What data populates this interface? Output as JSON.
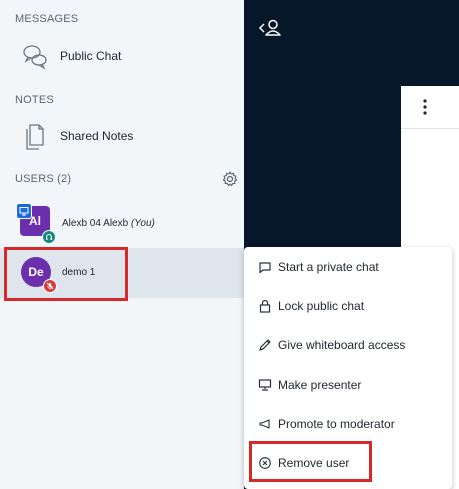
{
  "sidebar": {
    "messages_heading": "MESSAGES",
    "public_chat_label": "Public Chat",
    "notes_heading": "NOTES",
    "shared_notes_label": "Shared Notes",
    "users_heading": "USERS (2)",
    "users": [
      {
        "initials": "Al",
        "name": "Alexb 04 Alexb",
        "suffix": "(You)",
        "avatar_color": "#6b2fad",
        "role_badge": "presenter-icon",
        "status_badge": "headset-icon",
        "status_color": "#0f8a7d"
      },
      {
        "initials": "De",
        "name": "demo 1",
        "suffix": "",
        "avatar_color": "#6b2fad",
        "status_badge": "muted-mic-icon",
        "status_color": "#d63b3b"
      }
    ]
  },
  "context_menu": {
    "items": [
      {
        "label": "Start a private chat",
        "icon": "chat-bubble-icon"
      },
      {
        "label": "Lock public chat",
        "icon": "lock-icon"
      },
      {
        "label": "Give whiteboard access",
        "icon": "pencil-icon"
      },
      {
        "label": "Make presenter",
        "icon": "presentation-icon"
      },
      {
        "label": "Promote to moderator",
        "icon": "megaphone-icon"
      },
      {
        "label": "Remove user",
        "icon": "remove-circle-icon"
      }
    ]
  },
  "colors": {
    "highlight": "#d62a2a",
    "dark_panel": "#06172a",
    "sidebar_bg": "#f3f6f9",
    "selected_row": "#dfe5ec"
  }
}
